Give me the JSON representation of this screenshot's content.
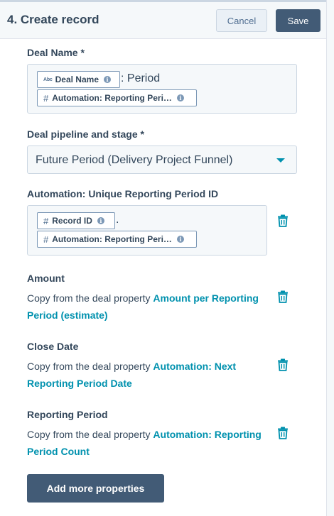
{
  "header": {
    "title": "4. Create record",
    "cancel_label": "Cancel",
    "save_label": "Save"
  },
  "deal_name": {
    "label": "Deal Name *",
    "token1": {
      "type_badge": "Abc",
      "text": "Deal Name"
    },
    "literal": ": Period",
    "token2": {
      "type_badge": "#",
      "text": "Automation: Reporting Peri…"
    }
  },
  "pipeline": {
    "label": "Deal pipeline and stage *",
    "value": "Future Period (Delivery Project Funnel)"
  },
  "unique_id": {
    "label": "Automation: Unique Reporting Period ID",
    "token1": {
      "type_badge": "#",
      "text": "Record ID"
    },
    "literal": ".",
    "token2": {
      "type_badge": "#",
      "text": "Automation: Reporting Peri…"
    }
  },
  "amount": {
    "label": "Amount",
    "prefix": "Copy from the deal property ",
    "link": "Amount per Reporting Period (estimate)"
  },
  "close_date": {
    "label": "Close Date",
    "prefix": "Copy from the deal property ",
    "link": "Automation: Next Reporting Period Date"
  },
  "reporting_period": {
    "label": "Reporting Period",
    "prefix": "Copy from the deal property ",
    "link": "Automation: Reporting Period Count"
  },
  "add_more_label": "Add more properties",
  "colors": {
    "accent_link": "#0091ae",
    "primary_button": "#425b76",
    "text": "#33475b"
  }
}
